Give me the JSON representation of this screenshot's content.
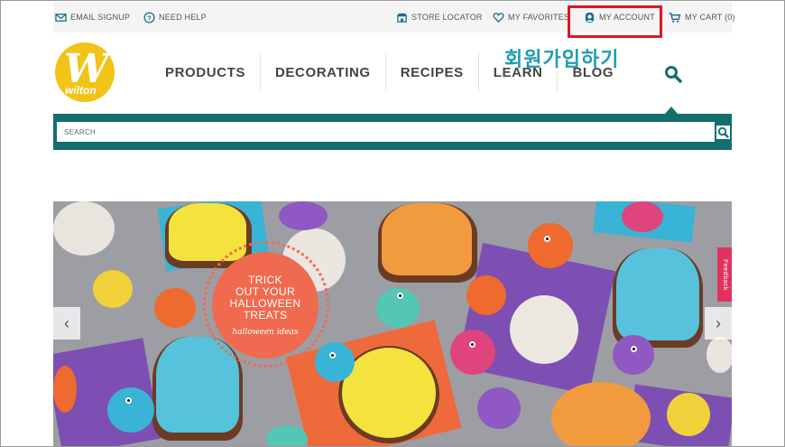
{
  "topbar": {
    "email_signup": "EMAIL SIGNUP",
    "need_help": "NEED HELP",
    "store_locator": "STORE LOCATOR",
    "my_favorites": "MY FAVORITES",
    "my_account": "MY ACCOUNT",
    "my_cart": "MY CART (0)"
  },
  "logo": {
    "text": "wilton"
  },
  "nav": {
    "items": [
      "PRODUCTS",
      "DECORATING",
      "RECIPES",
      "LEARN",
      "BLOG"
    ]
  },
  "annotation": {
    "korean_text": "회원가입하기",
    "highlight_color": "#e0151f"
  },
  "search": {
    "placeholder": "SEARCH"
  },
  "hero": {
    "badge_line1": "TRICK",
    "badge_line2": "OUT YOUR",
    "badge_line3": "HALLOWEEN",
    "badge_line4": "TREATS",
    "badge_sub": "halloween ideas",
    "prev_label": "‹",
    "next_label": "›"
  },
  "feedback": {
    "label": "Feedback"
  },
  "colors": {
    "teal": "#136e6e",
    "logo_yellow": "#f2c318",
    "badge": "#ef6a4e"
  }
}
